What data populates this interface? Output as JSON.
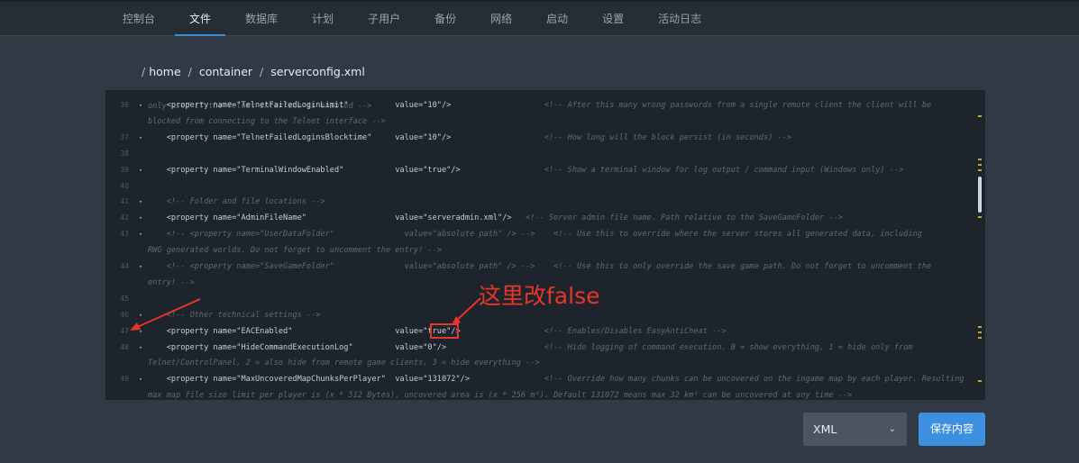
{
  "nav": {
    "items": [
      {
        "label": "控制台",
        "active": false
      },
      {
        "label": "文件",
        "active": true
      },
      {
        "label": "数据库",
        "active": false
      },
      {
        "label": "计划",
        "active": false
      },
      {
        "label": "子用户",
        "active": false
      },
      {
        "label": "备份",
        "active": false
      },
      {
        "label": "网络",
        "active": false
      },
      {
        "label": "启动",
        "active": false
      },
      {
        "label": "设置",
        "active": false
      },
      {
        "label": "活动日志",
        "active": false
      }
    ]
  },
  "breadcrumb": {
    "root": "/",
    "segments": [
      "home",
      "container",
      "serverconfig.xml"
    ],
    "separator": "/"
  },
  "editor": {
    "top_partial": "only used if the Telnet interface is enabled -->",
    "lines": [
      {
        "num": "36",
        "fold": "▾",
        "code": "    <property name=\"TelnetFailedLoginLimit\"          value=\"10\"/>                    <!-- After this many wrong passwords from a single remote client the client will be"
      },
      {
        "num": "",
        "fold": "",
        "cont": "blocked from connecting to the Telnet interface -->"
      },
      {
        "num": "37",
        "fold": "▾",
        "code": "    <property name=\"TelnetFailedLoginsBlocktime\"     value=\"10\"/>                    <!-- How long will the block persist (in seconds) -->"
      },
      {
        "num": "38",
        "fold": "",
        "code": ""
      },
      {
        "num": "39",
        "fold": "▾",
        "code": "    <property name=\"TerminalWindowEnabled\"           value=\"true\"/>                  <!-- Show a terminal window for log output / command input (Windows only) -->"
      },
      {
        "num": "40",
        "fold": "",
        "code": ""
      },
      {
        "num": "41",
        "fold": "▾",
        "code": "    <!-- Folder and file locations -->"
      },
      {
        "num": "42",
        "fold": "▾",
        "code": "    <property name=\"AdminFileName\"                   value=\"serveradmin.xml\"/>   <!-- Server admin file name. Path relative to the SaveGameFolder -->"
      },
      {
        "num": "43",
        "fold": "▾",
        "code": "    <!-- <property name=\"UserDataFolder\"               value=\"absolute path\" /> -->    <!-- Use this to override where the server stores all generated data, including"
      },
      {
        "num": "",
        "fold": "",
        "cont": "RWG generated worlds. Do not forget to uncomment the entry! -->"
      },
      {
        "num": "44",
        "fold": "▾",
        "code": "    <!-- <property name=\"SaveGameFolder\"               value=\"absolute path\" /> -->    <!-- Use this to only override the save game path. Do not forget to uncomment the"
      },
      {
        "num": "",
        "fold": "",
        "cont": "entry! -->"
      },
      {
        "num": "45",
        "fold": "",
        "code": ""
      },
      {
        "num": "46",
        "fold": "▾",
        "code": "    <!-- Other technical settings -->"
      },
      {
        "num": "47",
        "fold": "▾",
        "code": "    <property name=\"EACEnabled\"                      value=\"true\"/>                  <!-- Enables/Disables EasyAntiCheat -->"
      },
      {
        "num": "48",
        "fold": "▾",
        "code": "    <property name=\"HideCommandExecutionLog\"         value=\"0\"/>                     <!-- Hide logging of command execution. 0 = show everything, 1 = hide only from"
      },
      {
        "num": "",
        "fold": "",
        "cont": "Telnet/ControlPanel, 2 = also hide from remote game clients, 3 = hide everything -->"
      },
      {
        "num": "49",
        "fold": "▾",
        "code": "    <property name=\"MaxUncoveredMapChunksPerPlayer\"  value=\"131072\"/>                <!-- Override how many chunks can be uncovered on the ingame map by each player. Resulting"
      },
      {
        "num": "",
        "fold": "",
        "cont": "max map file size limit per player is (x * 512 Bytes), uncovered area is (x * 256 m²). Default 131072 means max 32 km² can be uncovered at any time -->"
      }
    ]
  },
  "annotation": {
    "text": "这里改false",
    "color": "#e8352a"
  },
  "footer": {
    "format_select": "XML",
    "save_label": "保存内容"
  },
  "colors": {
    "background": "#313a44",
    "topbar": "#252d35",
    "editor_bg": "#1e242b",
    "accent": "#3a8fd4",
    "save_button": "#3d8fe0"
  }
}
